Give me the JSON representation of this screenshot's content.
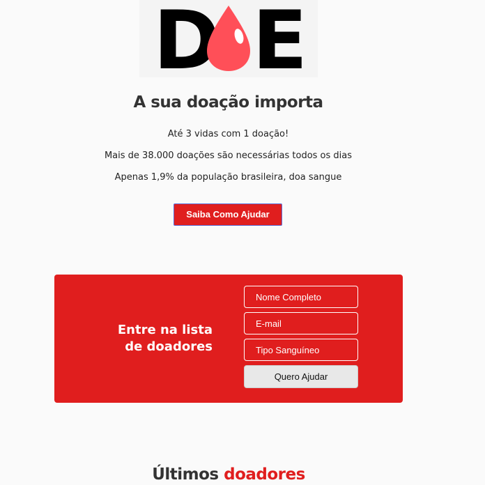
{
  "logo": {
    "letters": [
      "D",
      "E"
    ],
    "drop_color": "#ff4f58",
    "letter_color": "#000000",
    "icon": "blood-drop-icon"
  },
  "hero": {
    "title": "A sua doação importa",
    "lines": [
      "Até 3 vidas com 1 doação!",
      "Mais de 38.000 doações são necessárias todos os dias",
      "Apenas 1,9% da população brasileira, doa sangue"
    ],
    "cta_label": "Saiba Como Ajudar"
  },
  "donor_form": {
    "heading": "Entre na lista de doadores",
    "fields": {
      "name_placeholder": "Nome Completo",
      "email_placeholder": "E-mail",
      "blood_type_placeholder": "Tipo Sanguíneo"
    },
    "submit_label": "Quero Ajudar",
    "background_color": "#e01e1e"
  },
  "latest_donors": {
    "title_plain": "Últimos",
    "title_accent": "doadores",
    "accent_color": "#e01e1e"
  }
}
